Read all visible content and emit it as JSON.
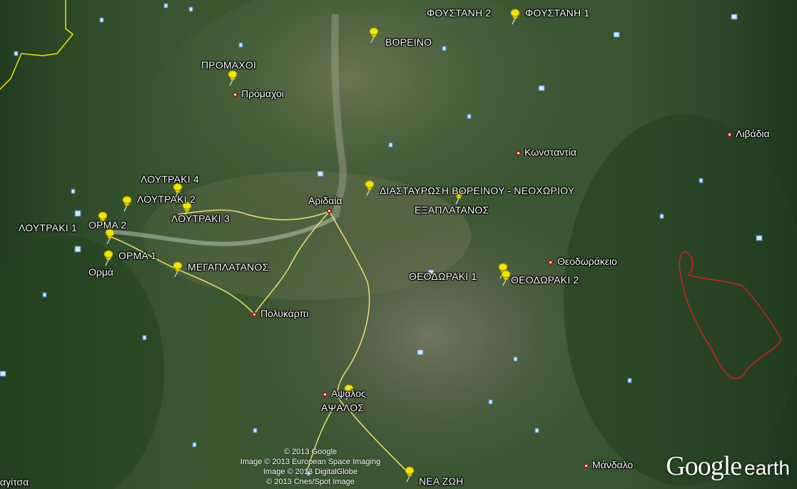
{
  "pins": [
    {
      "label": "ΦΟΥΣΤΑΝΗ 2"
    },
    {
      "label": "ΦΟΥΣΤΑΝΗ 1"
    },
    {
      "label": "ΒΟΡΕΙΝΟ"
    },
    {
      "label": "ΠΡΟΜΑΧΟΙ"
    },
    {
      "label": "ΛΟΥΤΡΑΚΙ 4"
    },
    {
      "label": "ΛΟΥΤΡΑΚΙ 2"
    },
    {
      "label": "ΛΟΥΤΡΑΚΙ 3"
    },
    {
      "label": "ΛΟΥΤΡΑΚΙ 1"
    },
    {
      "label": "ΟΡΜΑ 2"
    },
    {
      "label": "ΟΡΜΑ 1"
    },
    {
      "label": "ΜΕΓΑΠΛΑΤΑΝΟΣ"
    },
    {
      "label": "ΔΙΑΣΤΑΥΡΩΣΗ ΒΟΡΕΙΝΟΥ - ΝΕΟΧΩΡΙΟΥ"
    },
    {
      "label": "ΕΞΑΠΛΑΤΑΝΟΣ"
    },
    {
      "label": "ΘΕΟΔΩΡΑΚΙ 1"
    },
    {
      "label": "ΘΕΟΔΩΡΑΚΙ 2"
    },
    {
      "label": "ΑΨΑΛΟΣ"
    },
    {
      "label": "ΝΕΑ ΖΩΗ"
    }
  ],
  "places": [
    {
      "name": "Πρόμαχοι"
    },
    {
      "name": "Κωνσταντία"
    },
    {
      "name": "Λιβάδια"
    },
    {
      "name": "Αριδαία"
    },
    {
      "name": "Ορμά"
    },
    {
      "name": "Θεοδωράκειο"
    },
    {
      "name": "Πολυκάρπι"
    },
    {
      "name": "Αψαλος"
    },
    {
      "name": "Μάνδαλο"
    },
    {
      "name": "αγίτσα"
    }
  ],
  "copyright": {
    "line1": "© 2013 Google",
    "line2": "Image © 2013 European Space Imaging",
    "line3": "Image © 2013 DigitalGlobe",
    "line4": "© 2013 Cnes/Spot Image"
  },
  "logo": {
    "brand": "Google",
    "product": "earth"
  },
  "colors": {
    "pin": "#f2e600",
    "road": "#e8e070",
    "border": "#f2e600",
    "boundary": "#d02020",
    "place_dot": "#a01818"
  }
}
